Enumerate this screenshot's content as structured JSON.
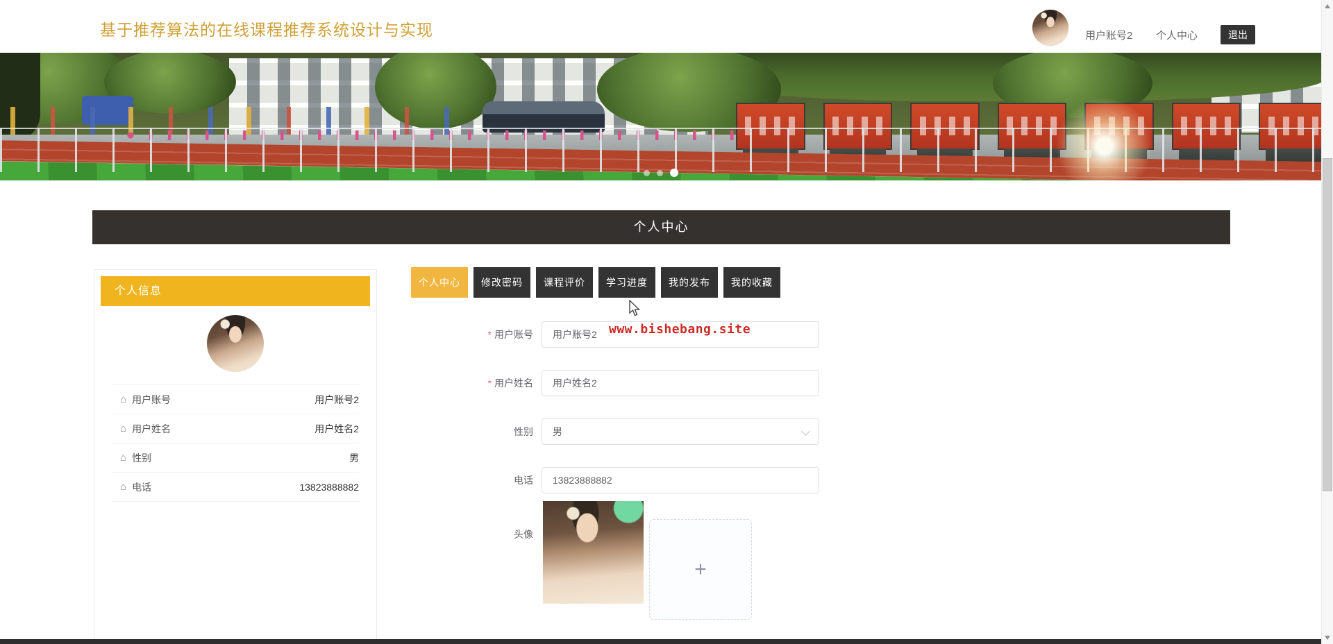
{
  "header": {
    "title": "基于推荐算法的在线课程推荐系统设计与实现",
    "username": "用户账号2",
    "nav_personal_center": "个人中心",
    "logout_label": "退出"
  },
  "banner": {
    "dot_count": 3,
    "active_dot": 2
  },
  "page_title": "个人中心",
  "sidebar": {
    "title": "个人信息",
    "items": [
      {
        "label": "用户账号",
        "value": "用户账号2"
      },
      {
        "label": "用户姓名",
        "value": "用户姓名2"
      },
      {
        "label": "性别",
        "value": "男"
      },
      {
        "label": "电话",
        "value": "13823888882"
      }
    ]
  },
  "tabs": [
    {
      "label": "个人中心",
      "active": true
    },
    {
      "label": "修改密码",
      "active": false
    },
    {
      "label": "课程评价",
      "active": false
    },
    {
      "label": "学习进度",
      "active": false
    },
    {
      "label": "我的发布",
      "active": false
    },
    {
      "label": "我的收藏",
      "active": false
    }
  ],
  "form": {
    "watermark": "www.bishebang.site",
    "upload_plus": "+",
    "fields": [
      {
        "name": "account",
        "label": "用户账号",
        "value": "用户账号2",
        "required": true,
        "type": "text"
      },
      {
        "name": "fullname",
        "label": "用户姓名",
        "value": "用户姓名2",
        "required": true,
        "type": "text"
      },
      {
        "name": "gender",
        "label": "性别",
        "value": "男",
        "required": false,
        "type": "select"
      },
      {
        "name": "phone",
        "label": "电话",
        "value": "13823888882",
        "required": false,
        "type": "text"
      },
      {
        "name": "avatar",
        "label": "头像",
        "value": "",
        "required": false,
        "type": "upload"
      }
    ]
  },
  "icons": {
    "home_glyph": "⌂"
  },
  "colors": {
    "title_gold": "#CFA138",
    "accent_yellow": "#EFB41E",
    "tab_active_yellow": "#F0B63F",
    "dark": "#333333",
    "watermark_red": "#CC2B27",
    "required_red": "#F56C6C"
  }
}
